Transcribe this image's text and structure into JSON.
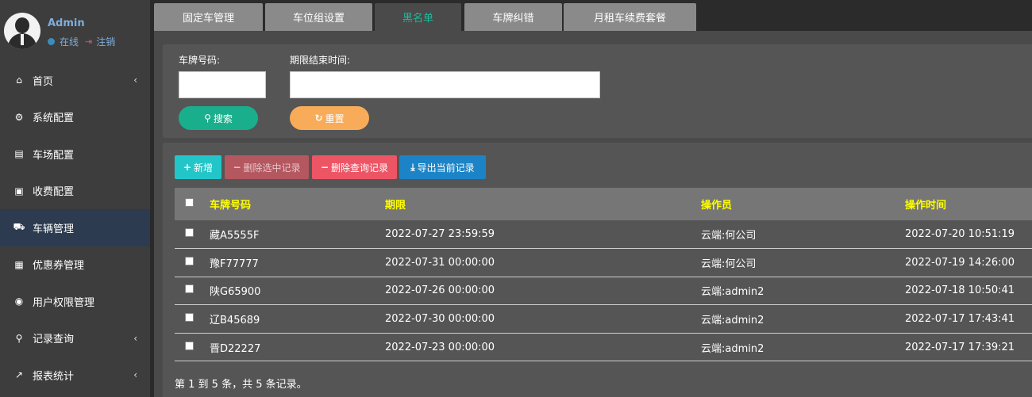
{
  "user": {
    "name": "Admin",
    "status": "在线",
    "logout": "注销"
  },
  "sidebar": {
    "items": [
      {
        "label": "首页",
        "icon": "home-icon",
        "glyph": "⌂",
        "chevron": true
      },
      {
        "label": "系统配置",
        "icon": "cogs-icon",
        "glyph": "⚙",
        "chevron": false
      },
      {
        "label": "车场配置",
        "icon": "file-icon",
        "glyph": "▤",
        "chevron": false
      },
      {
        "label": "收费配置",
        "icon": "money-icon",
        "glyph": "▣",
        "chevron": false
      },
      {
        "label": "车辆管理",
        "icon": "car-icon",
        "glyph": "⛟",
        "chevron": false,
        "active": true
      },
      {
        "label": "优惠券管理",
        "icon": "calendar-icon",
        "glyph": "▦",
        "chevron": false
      },
      {
        "label": "用户权限管理",
        "icon": "user-circle-icon",
        "glyph": "◉",
        "chevron": false
      },
      {
        "label": "记录查询",
        "icon": "search-icon",
        "glyph": "⚲",
        "chevron": true
      },
      {
        "label": "报表统计",
        "icon": "line-chart-icon",
        "glyph": "↗",
        "chevron": true
      }
    ]
  },
  "tabs": [
    {
      "label": "固定车管理"
    },
    {
      "label": "车位组设置"
    },
    {
      "label": "黑名单",
      "active": true
    },
    {
      "label": "车牌纠错"
    },
    {
      "label": "月租车续费套餐"
    }
  ],
  "search": {
    "plate_label": "车牌号码:",
    "plate_value": "",
    "expiry_label": "期限结束时间:",
    "expiry_value": "",
    "search_button": "搜索",
    "reset_button": "重置"
  },
  "toolbar": {
    "add": "新增",
    "delete_selected": "删除选中记录",
    "delete_query": "删除查询记录",
    "export": "导出当前记录"
  },
  "table": {
    "headers": {
      "plate": "车牌号码",
      "expiry": "期限",
      "operator": "操作员",
      "time": "操作时间"
    },
    "rows": [
      {
        "plate": "藏A5555F",
        "expiry": "2022-07-27 23:59:59",
        "operator": "云端:何公司",
        "time": "2022-07-20 10:51:19"
      },
      {
        "plate": "豫F77777",
        "expiry": "2022-07-31 00:00:00",
        "operator": "云端:何公司",
        "time": "2022-07-19 14:26:00"
      },
      {
        "plate": "陕G65900",
        "expiry": "2022-07-26 00:00:00",
        "operator": "云端:admin2",
        "time": "2022-07-18 10:50:41"
      },
      {
        "plate": "辽B45689",
        "expiry": "2022-07-30 00:00:00",
        "operator": "云端:admin2",
        "time": "2022-07-17 17:43:41"
      },
      {
        "plate": "晋D22227",
        "expiry": "2022-07-23 00:00:00",
        "operator": "云端:admin2",
        "time": "2022-07-17 17:39:21"
      }
    ]
  },
  "pagination": {
    "summary": "第 1 到 5 条，共 5 条记录。"
  },
  "colors": {
    "teal": "#1abc9c",
    "orange": "#f8ac59",
    "cyan": "#23c6c8",
    "danger_muted": "#b5575f",
    "danger": "#ed5565",
    "primary": "#1c84c6",
    "header_text": "#ffff00"
  }
}
